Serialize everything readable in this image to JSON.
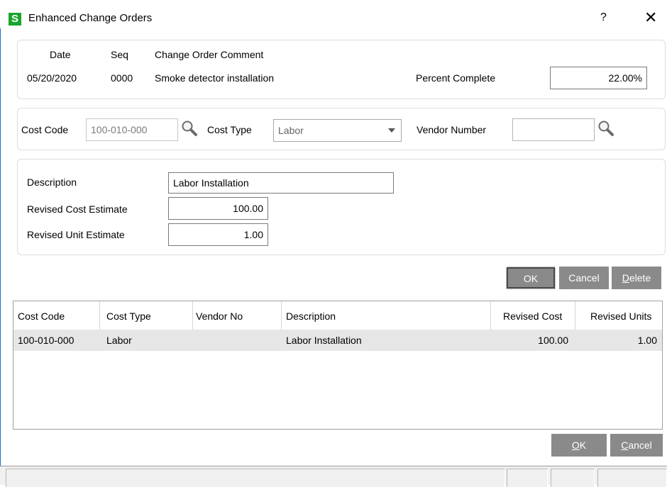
{
  "window": {
    "app_icon_letter": "S",
    "title": "Enhanced Change Orders",
    "help_label": "?",
    "close_label": "✕"
  },
  "header_panel": {
    "date_label": "Date",
    "seq_label": "Seq",
    "comment_label": "Change Order Comment",
    "date_value": "05/20/2020",
    "seq_value": "0000",
    "comment_value": "Smoke detector installation",
    "percent_label": "Percent Complete",
    "percent_value": "22.00%"
  },
  "cost_panel": {
    "cost_code_label": "Cost Code",
    "cost_code_value": "100-010-000",
    "cost_type_label": "Cost Type",
    "cost_type_value": "Labor",
    "vendor_label": "Vendor Number",
    "vendor_value": ""
  },
  "detail_panel": {
    "description_label": "Description",
    "description_value": "Labor Installation",
    "revised_cost_label": "Revised Cost Estimate",
    "revised_cost_value": "100.00",
    "revised_unit_label": "Revised Unit Estimate",
    "revised_unit_value": "1.00"
  },
  "line_buttons": {
    "ok": "OK",
    "cancel": "Cancel",
    "delete_first": "D",
    "delete_rest": "elete"
  },
  "grid": {
    "columns": [
      "Cost Code",
      "Cost Type",
      "Vendor No",
      "Description",
      "Revised Cost",
      "Revised Units"
    ],
    "rows": [
      [
        "100-010-000",
        "Labor",
        "",
        "Labor Installation",
        "100.00",
        "1.00"
      ]
    ]
  },
  "footer_buttons": {
    "ok_first": "O",
    "ok_rest": "K",
    "cancel_first": "C",
    "cancel_rest": "ancel"
  },
  "colors": {
    "app_icon": "#19a52d",
    "button_bg": "#8a8a8a",
    "selected_row": "#e6e6e6",
    "window_edge": "#1a73c8"
  }
}
